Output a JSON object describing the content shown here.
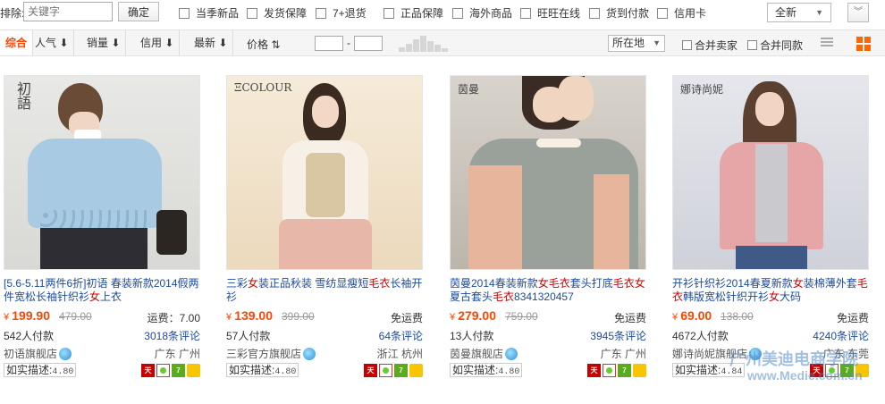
{
  "filter": {
    "exclude_label": "排除:",
    "exclude_placeholder": "关键字",
    "confirm_label": "确定",
    "checkboxes": [
      "当季新品",
      "发货保障",
      "7+退货",
      "正品保障",
      "海外商品",
      "旺旺在线",
      "货到付款",
      "信用卡"
    ],
    "all_select": "全新"
  },
  "sortbar": {
    "items": [
      "综合",
      "人气",
      "销量",
      "信用",
      "最新"
    ],
    "price_label": "价格",
    "location_label": "所在地",
    "merge_seller": "合并卖家",
    "merge_same": "合并同款"
  },
  "products": [
    {
      "title_parts": [
        {
          "t": "[5.6-5.11两件6折]初语 春装新款2014假两件宽松长袖针织衫",
          "hl": false
        },
        {
          "t": "女",
          "hl": true
        },
        {
          "t": "上衣",
          "hl": false
        }
      ],
      "logo": "初語",
      "price": "199.90",
      "old_price": "479.00",
      "shipping": "运费：7.00",
      "paid": "542人付款",
      "reviews": "3018条评论",
      "shop": "初语旗舰店",
      "location": "广东 广州",
      "desc_label": "如实描述:",
      "desc_score": "4.80"
    },
    {
      "title_parts": [
        {
          "t": "三彩",
          "hl": false
        },
        {
          "t": "女",
          "hl": true
        },
        {
          "t": "装正品秋装 雪纺显瘦短",
          "hl": false
        },
        {
          "t": "毛衣",
          "hl": true
        },
        {
          "t": "长袖开衫",
          "hl": false
        }
      ],
      "logo": "ΞCOLOUR",
      "price": "139.00",
      "old_price": "399.00",
      "shipping": "免运费",
      "paid": "57人付款",
      "reviews": "64条评论",
      "shop": "三彩官方旗舰店",
      "location": "浙江 杭州",
      "desc_label": "如实描述:",
      "desc_score": "4.80"
    },
    {
      "title_parts": [
        {
          "t": "茵曼2014春装新款",
          "hl": false
        },
        {
          "t": "女毛衣",
          "hl": true
        },
        {
          "t": "套头打底",
          "hl": false
        },
        {
          "t": "毛衣",
          "hl": true
        },
        {
          "t": "女",
          "hl": true
        },
        {
          "t": "夏古套头",
          "hl": false
        },
        {
          "t": "毛衣",
          "hl": true
        },
        {
          "t": "8341320457",
          "hl": false
        }
      ],
      "logo": "茵曼",
      "price": "279.00",
      "old_price": "759.00",
      "shipping": "免运费",
      "paid": "13人付款",
      "reviews": "3945条评论",
      "shop": "茵曼旗舰店",
      "location": "广东 广州",
      "desc_label": "如实描述:",
      "desc_score": "4.80"
    },
    {
      "title_parts": [
        {
          "t": "开衫针织衫2014春夏新款",
          "hl": false
        },
        {
          "t": "女",
          "hl": true
        },
        {
          "t": "装棉薄外套",
          "hl": false
        },
        {
          "t": "毛衣",
          "hl": true
        },
        {
          "t": "韩版宽松针织开衫",
          "hl": false
        },
        {
          "t": "女",
          "hl": true
        },
        {
          "t": "大码",
          "hl": false
        }
      ],
      "logo": "娜诗尚妮",
      "price": "69.00",
      "old_price": "138.00",
      "shipping": "免运费",
      "paid": "4672人付款",
      "reviews": "4240条评论",
      "shop": "娜诗尚妮旗舰店",
      "location": "广东 东莞",
      "desc_label": "如实描述:",
      "desc_score": "4.84"
    }
  ],
  "watermark": {
    "line1": "广州美迪电商学院",
    "line2": "www.Medie.com.cn"
  }
}
